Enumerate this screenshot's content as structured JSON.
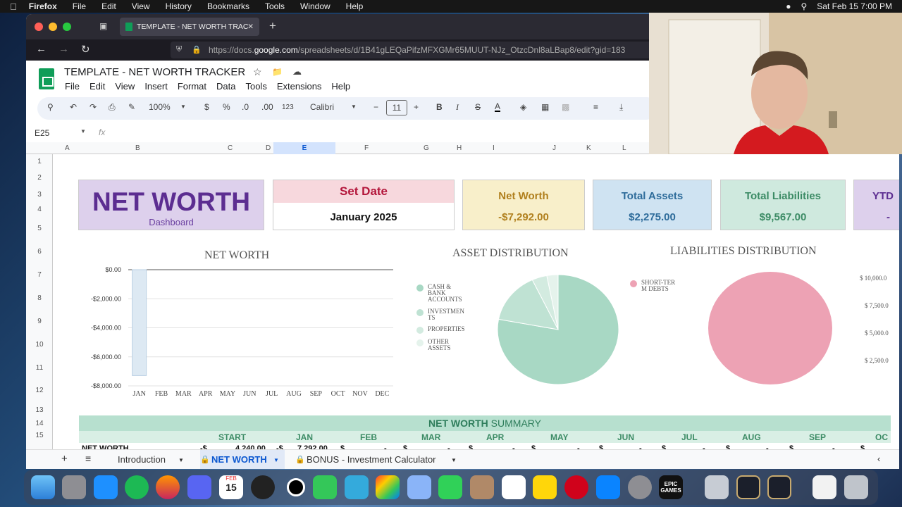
{
  "menubar": {
    "app": "Firefox",
    "items": [
      "File",
      "Edit",
      "View",
      "History",
      "Bookmarks",
      "Tools",
      "Window",
      "Help"
    ],
    "clock": "Sat Feb 15  7:00 PM"
  },
  "browser": {
    "tab_title": "TEMPLATE - NET WORTH TRAC",
    "url_prefix": "https://docs.",
    "url_host": "google.com",
    "url_path": "/spreadsheets/d/1B41gLEQaPifzMFXGMr65MUUT-NJz_OtzcDnl8aLBap8/edit?gid=183"
  },
  "sheets": {
    "doc_title": "TEMPLATE - NET WORTH TRACKER",
    "menu": [
      "File",
      "Edit",
      "View",
      "Insert",
      "Format",
      "Data",
      "Tools",
      "Extensions",
      "Help"
    ],
    "toolbar": {
      "zoom": "100%",
      "currency": "$",
      "percent": "%",
      "dec_less": ".0",
      "dec_more": ".00",
      "num_format": "123",
      "font": "Calibri",
      "font_size": "11"
    },
    "name_box": "E25",
    "fx": "fx",
    "columns": [
      "A",
      "B",
      "C",
      "D",
      "E",
      "F",
      "G",
      "H",
      "I",
      "J",
      "K",
      "L"
    ],
    "rows": [
      "1",
      "2",
      "3",
      "4",
      "5",
      "6",
      "7",
      "8",
      "9",
      "10",
      "11",
      "12",
      "13",
      "14",
      "15"
    ]
  },
  "dashboard": {
    "title": "NET WORTH",
    "subtitle": "Dashboard",
    "set_date_label": "Set Date",
    "set_date_value": "January 2025",
    "kpis": [
      {
        "label": "Net Worth",
        "value": "-$7,292.00"
      },
      {
        "label": "Total Assets",
        "value": "$2,275.00"
      },
      {
        "label": "Total Liabilities",
        "value": "$9,567.00"
      },
      {
        "label": "YTD",
        "value": "-"
      }
    ]
  },
  "chart_data": [
    {
      "type": "bar",
      "title": "NET WORTH",
      "categories": [
        "JAN",
        "FEB",
        "MAR",
        "APR",
        "MAY",
        "JUN",
        "JUL",
        "AUG",
        "SEP",
        "OCT",
        "NOV",
        "DEC"
      ],
      "values": [
        -7292,
        0,
        0,
        0,
        0,
        0,
        0,
        0,
        0,
        0,
        0,
        0
      ],
      "ylim": [
        -8000,
        0
      ],
      "yticks": [
        "$0.00",
        "-$2,000.00",
        "-$4,000.00",
        "-$6,000.00",
        "-$8,000.00"
      ],
      "color": "#dde9f3",
      "grid": true
    },
    {
      "type": "pie",
      "title": "ASSET DISTRIBUTION",
      "labels": [
        "CASH & BANK ACCOUNTS",
        "INVESTMENTS",
        "PROPERTIES",
        "OTHER ASSETS"
      ],
      "legend_labels": [
        "CASH &",
        "BANK",
        "ACCOUNTS",
        "INVESTMEN",
        "TS",
        "PROPERTIES",
        "OTHER",
        "ASSETS"
      ],
      "values": [
        78,
        15,
        4,
        3
      ],
      "colors": [
        "#a8d8c4",
        "#bfe2d3",
        "#d3ebe0",
        "#e5f3ec"
      ],
      "legend": "left"
    },
    {
      "type": "pie",
      "title": "LIABILITIES DISTRIBUTION",
      "labels": [
        "SHORT-TERM DEBTS"
      ],
      "legend_labels": [
        "SHORT-TER",
        "M DEBTS"
      ],
      "values": [
        100
      ],
      "colors": [
        "#eda2b4"
      ],
      "legend": "left",
      "side_ticks": [
        "$ 10,000.0",
        "$ 7,500.0",
        "$ 5,000.0",
        "$ 2,500.0"
      ]
    }
  ],
  "summary": {
    "title_bold": "NET WORTH",
    "title_rest": " SUMMARY",
    "headers": [
      "START",
      "JAN",
      "FEB",
      "MAR",
      "APR",
      "MAY",
      "JUN",
      "JUL",
      "AUG",
      "SEP",
      "OC"
    ],
    "row_label": "NET WORTH",
    "start": "4,240.00",
    "jan": "7,292.00"
  },
  "sheet_tabs": [
    "Introduction",
    "NET WORTH",
    "BONUS - Investment Calculator"
  ],
  "dock": {
    "calendar_month": "FEB",
    "calendar_day": "15",
    "epic_label": "EPIC GAMES"
  }
}
